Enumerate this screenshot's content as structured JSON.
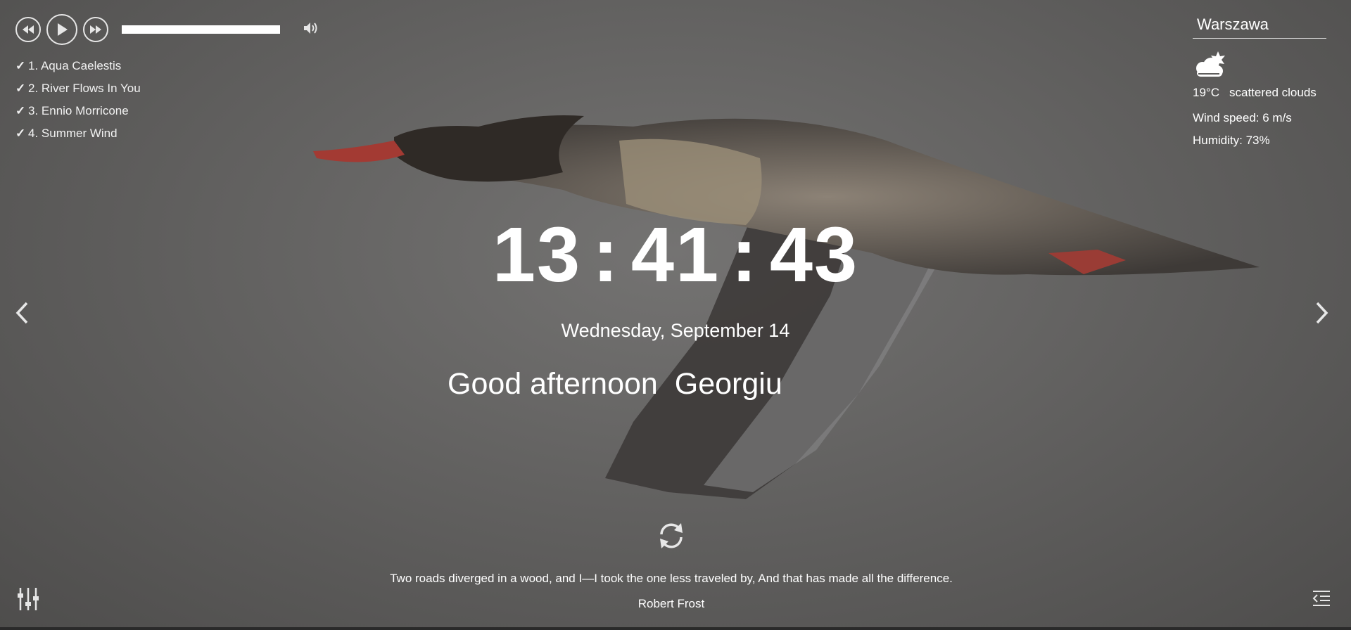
{
  "player": {
    "icons": [
      "rewind-icon",
      "play-icon",
      "fast-forward-icon",
      "volume-icon"
    ],
    "playlist": [
      {
        "label": "1. Aqua Caelestis"
      },
      {
        "label": "2. River Flows In You"
      },
      {
        "label": "3. Ennio Morricone"
      },
      {
        "label": "4. Summer Wind"
      }
    ]
  },
  "weather": {
    "city": "Warszawa",
    "icon": "scattered-clouds-icon",
    "temperature": "19°C",
    "description": "scattered clouds",
    "wind": "Wind speed: 6 m/s",
    "humidity": "Humidity: 73%"
  },
  "clock": {
    "hours": "13",
    "minutes": "41",
    "seconds": "43",
    "separator": ":"
  },
  "date": "Wednesday, September 14",
  "greeting": {
    "text": "Good afternoon",
    "name": "Georgiu"
  },
  "quote": {
    "text": "Two roads diverged in a wood, and I—I took the one less traveled by, And that has made all the difference.",
    "author": "Robert Frost"
  },
  "colors": {
    "text": "#ffffff",
    "overlay": "#5f5e5d"
  }
}
